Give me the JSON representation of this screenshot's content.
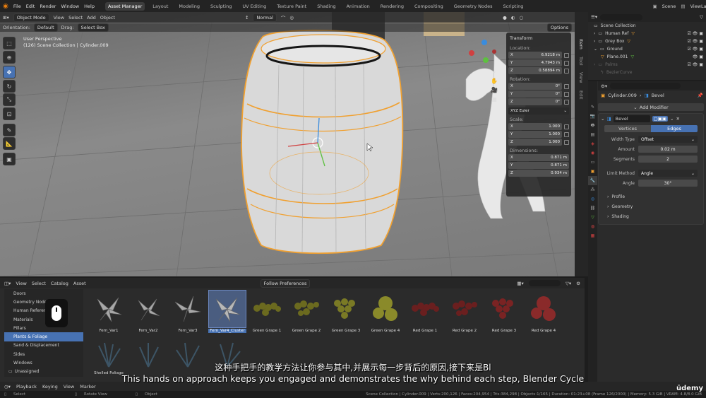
{
  "topbar": {
    "menus": [
      "File",
      "Edit",
      "Render",
      "Window",
      "Help"
    ],
    "workspaces": [
      "Asset Manager",
      "Layout",
      "Modeling",
      "Sculpting",
      "UV Editing",
      "Texture Paint",
      "Shading",
      "Animation",
      "Rendering",
      "Compositing",
      "Geometry Nodes",
      "Scripting"
    ],
    "active_workspace": "Asset Manager",
    "scene": "Scene",
    "view_layer": "ViewLayer"
  },
  "viewport": {
    "mode": "Object Mode",
    "menus": [
      "View",
      "Select",
      "Add",
      "Object"
    ],
    "orientation_label": "Orientation:",
    "orientation": "Default",
    "drag_label": "Drag:",
    "drag": "Select Box",
    "pivot": "Normal",
    "options": "Options",
    "info_line1": "User Perspective",
    "info_line2": "(126) Scene Collection | Cylinder.009",
    "side_tabs": [
      "Item",
      "Tool",
      "View",
      "Edit"
    ]
  },
  "npanel": {
    "title": "Transform",
    "location_label": "Location:",
    "location": [
      {
        "axis": "X",
        "value": "6.9218 m"
      },
      {
        "axis": "Y",
        "value": "4.7943 m"
      },
      {
        "axis": "Z",
        "value": "0.58894 m"
      }
    ],
    "rotation_label": "Rotation:",
    "rotation": [
      {
        "axis": "X",
        "value": "0°"
      },
      {
        "axis": "Y",
        "value": "0°"
      },
      {
        "axis": "Z",
        "value": "0°"
      }
    ],
    "rotation_mode": "XYZ Euler",
    "scale_label": "Scale:",
    "scale": [
      {
        "axis": "X",
        "value": "1.000"
      },
      {
        "axis": "Y",
        "value": "1.000"
      },
      {
        "axis": "Z",
        "value": "1.000"
      }
    ],
    "dimensions_label": "Dimensions:",
    "dimensions": [
      {
        "axis": "X",
        "value": "0.871 m"
      },
      {
        "axis": "Y",
        "value": "0.871 m"
      },
      {
        "axis": "Z",
        "value": "0.934 m"
      }
    ]
  },
  "outliner": {
    "rows": [
      {
        "label": "Scene Collection",
        "style": "root"
      },
      {
        "label": "Human Ref",
        "style": "item"
      },
      {
        "label": "Grey Box",
        "style": "item"
      },
      {
        "label": "Ground",
        "style": "item"
      },
      {
        "label": "Plane.001",
        "style": "child"
      },
      {
        "label": "Palms",
        "style": "dim"
      },
      {
        "label": "BezierCurve",
        "style": "dim"
      }
    ]
  },
  "properties": {
    "object": "Cylinder.009",
    "modifier_crumb": "Bevel",
    "add_modifier": "Add Modifier",
    "modifier_name": "Bevel",
    "tabs": [
      "Vertices",
      "Edges"
    ],
    "active_tab": "Edges",
    "fields": [
      {
        "label": "Width Type",
        "value": "Offset",
        "type": "select"
      },
      {
        "label": "Amount",
        "value": "0.02 m",
        "type": "num"
      },
      {
        "label": "Segments",
        "value": "2",
        "type": "num"
      },
      {
        "label": "Limit Method",
        "value": "Angle",
        "type": "select"
      },
      {
        "label": "Angle",
        "value": "30°",
        "type": "num"
      }
    ],
    "sections": [
      "Profile",
      "Geometry",
      "Shading"
    ]
  },
  "asset_browser": {
    "menus": [
      "View",
      "Select",
      "Catalog",
      "Asset"
    ],
    "import_mode": "Follow Preferences",
    "categories": [
      "Doors",
      "Geometry Nodes",
      "Human Reference",
      "Materials",
      "Pillars",
      "Plants & Foliage",
      "Sand & Displacement",
      "Sides",
      "Windows",
      "Unassigned"
    ],
    "active_category": "Plants & Foliage",
    "assets": [
      "Fern_Var1",
      "Fern_Var2",
      "Fern_Var3",
      "Fern_Var4_Cluster",
      "Green Grape 1",
      "Green Grape 2",
      "Green Grape 3",
      "Green Grape 4",
      "Red Grape 1",
      "Red Grape 2",
      "Red Grape 3",
      "Red Grape 4"
    ],
    "selected_asset": "Fern_Var4_Cluster",
    "row2_labels": [
      "Shelled Foliage"
    ]
  },
  "timeline": {
    "menus": [
      "Playback",
      "Keying",
      "View",
      "Marker"
    ]
  },
  "statusbar": {
    "items": [
      "Select",
      "Rotate View",
      "Object"
    ],
    "stats": "Scene Collection | Cylinder.009 | Verts:200,126 | Faces:204,954 | Tris:384,298 | Objects:1/165 | Duration: 01:23+08 (Frame 126/2000) | Memory: 5.3 GiB | VRAM: 4.8/8.0 GiB"
  },
  "subtitles": {
    "chinese": "这种手把手的教学方法让你参与其中,并展示每一步背后的原因,接下来是Bl",
    "english": "This hands on approach keeps you engaged and demonstrates the why behind each step, Blender Cycle"
  },
  "watermark": "ūdemy",
  "colors": {
    "accent": "#4772b3",
    "selection_orange": "#f0a030"
  }
}
